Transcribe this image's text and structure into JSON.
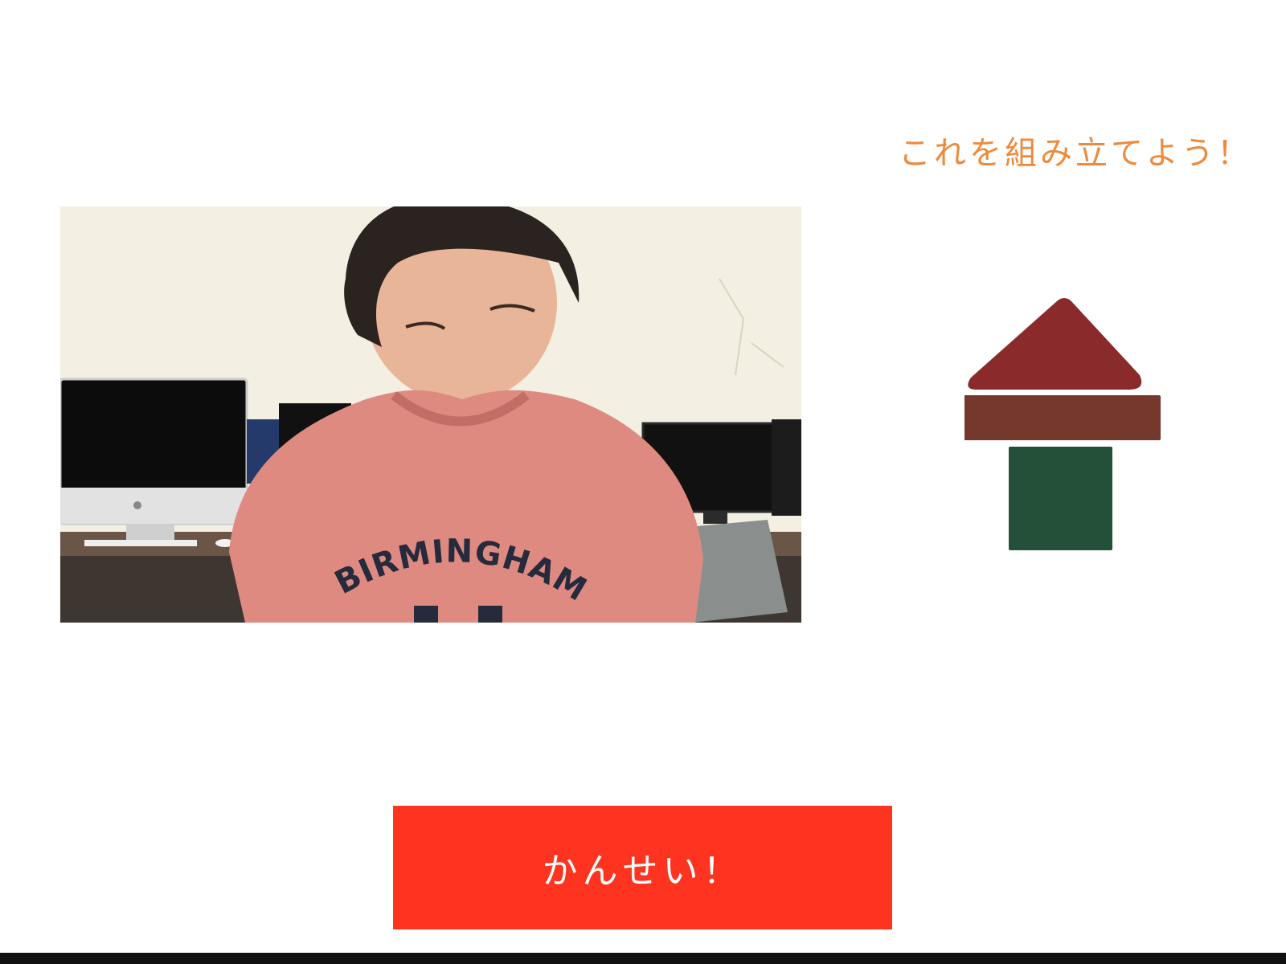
{
  "instruction": {
    "text": "これを組み立てよう！",
    "color": "#ee8a3c"
  },
  "camera": {
    "shirt_text": "BIRMINGHAM"
  },
  "target_model": {
    "blocks": [
      {
        "name": "roof-triangle",
        "shape": "triangle",
        "color": "#8b2a2a"
      },
      {
        "name": "beam-rectangle",
        "shape": "rectangle",
        "color": "#74382c"
      },
      {
        "name": "base-square",
        "shape": "square",
        "color": "#24503a"
      }
    ]
  },
  "finish_button": {
    "label": "かんせい！",
    "color": "#ff3420"
  }
}
